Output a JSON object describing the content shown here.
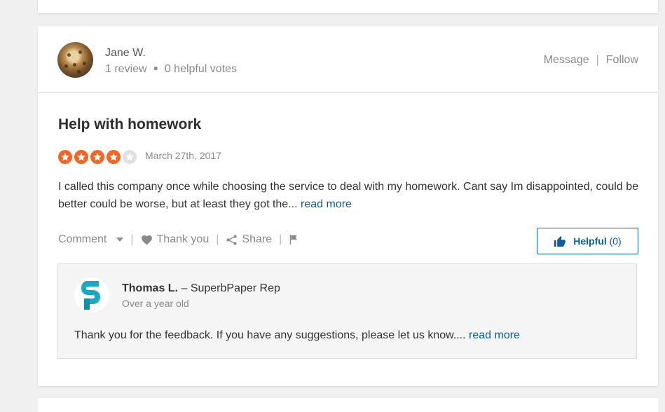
{
  "review": {
    "user": {
      "name": "Jane W.",
      "reviews": "1 review",
      "helpful_votes": "0 helpful votes"
    },
    "header_actions": {
      "message": "Message",
      "separator": "|",
      "follow": "Follow"
    },
    "title": "Help with homework",
    "rating": 4,
    "rating_max": 5,
    "date": "March 27th, 2017",
    "text": "I called this company once while choosing the service to deal with my homework. Cant say Im disappointed, could be better could be worse, but at least they got the...",
    "read_more": "read more",
    "actions": {
      "comment": "Comment",
      "thank_you": "Thank you",
      "share": "Share"
    },
    "helpful": {
      "label": "Helpful",
      "count": "(0)"
    },
    "reply": {
      "author": "Thomas L.",
      "role": "– SuperbPaper Rep",
      "time": "Over a year old",
      "text": "Thank you for the feedback. If you have any suggestions, please let us know....",
      "read_more": "read more"
    }
  },
  "colors": {
    "star": "#f26522",
    "link": "#0b5d9e",
    "logo": "#1aa9c0"
  }
}
